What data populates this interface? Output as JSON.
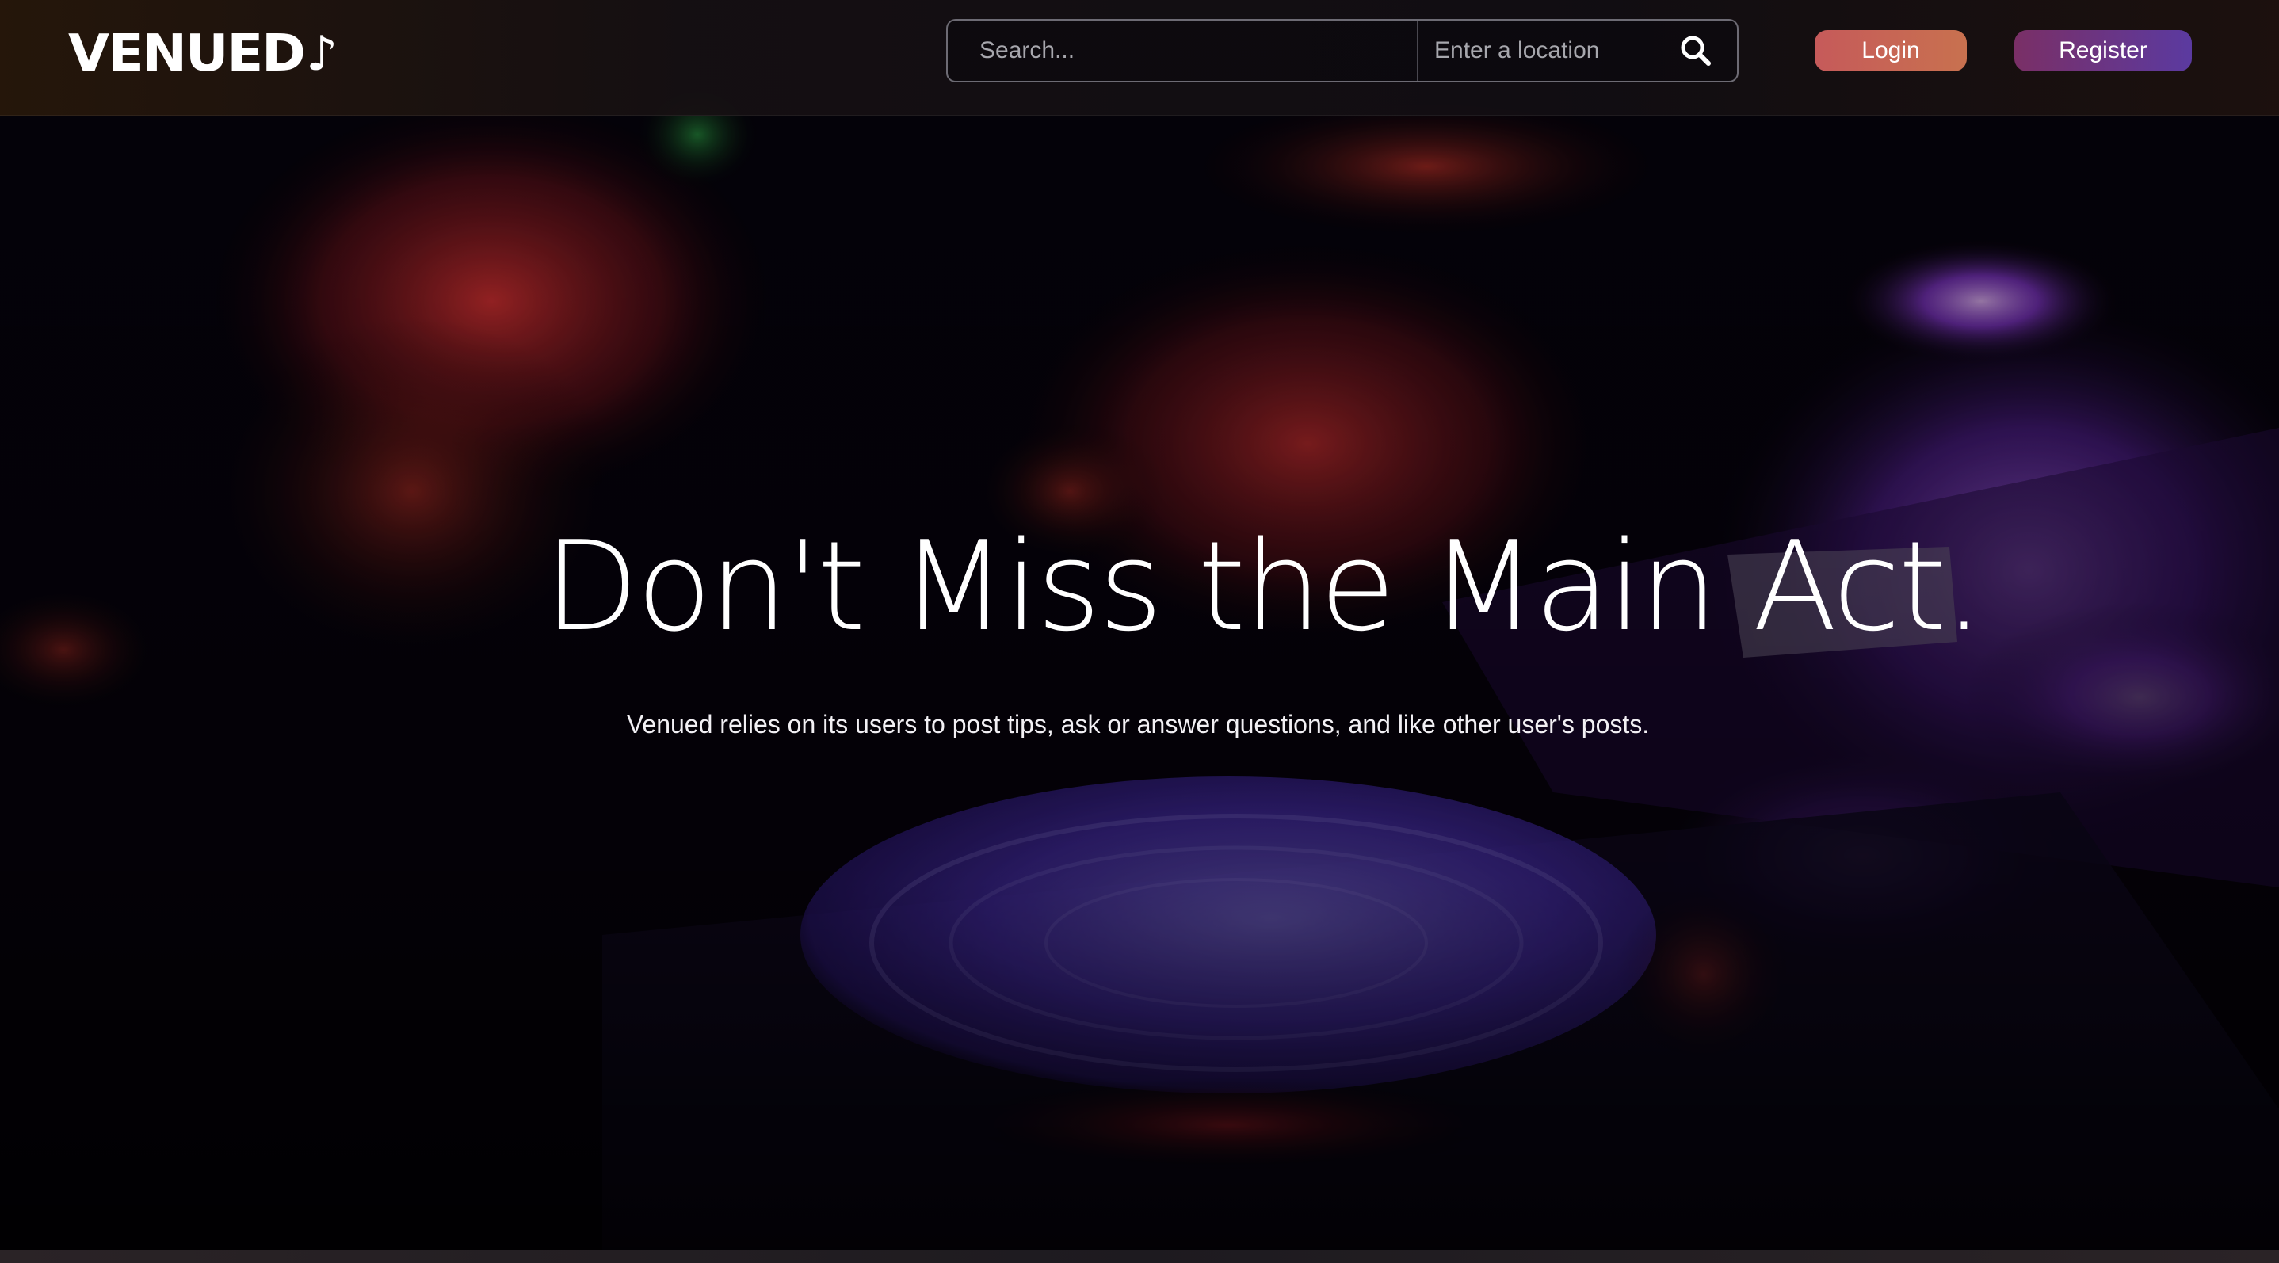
{
  "header": {
    "logo_text": "VENUED",
    "search": {
      "query_placeholder": "Search...",
      "location_placeholder": "Enter a location",
      "search_icon": "magnifier-icon"
    },
    "login_label": "Login",
    "register_label": "Register"
  },
  "hero": {
    "title": "Don't Miss the Main Act.",
    "subtitle": "Venued relies on its users to post tips, ask or answer questions, and like other user's posts."
  },
  "colors": {
    "login_start": "#c65a5a",
    "login_end": "#c8714f",
    "register_start": "#7a2f66",
    "register_end": "#5b3aa0",
    "hero_purple": "#9b4dff",
    "hero_red": "#e2363a"
  }
}
